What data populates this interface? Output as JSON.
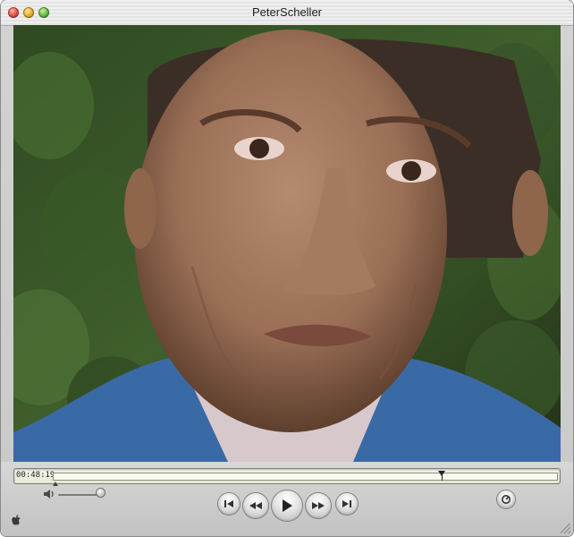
{
  "window": {
    "title": "PeterScheller"
  },
  "video": {
    "description_icon": "video-frame"
  },
  "playback": {
    "time_display": "00:48:19",
    "position_fraction": 0.772,
    "volume_fraction": 1.0
  },
  "icons": {
    "close": "close-icon",
    "minimize": "minimize-icon",
    "zoom": "zoom-icon",
    "volume": "speaker-icon",
    "previous": "skip-back-icon",
    "rewind": "rewind-icon",
    "play": "play-icon",
    "fast_forward": "fast-forward-icon",
    "next": "skip-forward-icon",
    "adjustments": "adjustments-icon",
    "apple": "apple-icon"
  },
  "colors": {
    "timeline_bg": "#f6f6ea",
    "close": "#e0443a",
    "minimize": "#e0a81f",
    "zoom": "#5bb236"
  }
}
